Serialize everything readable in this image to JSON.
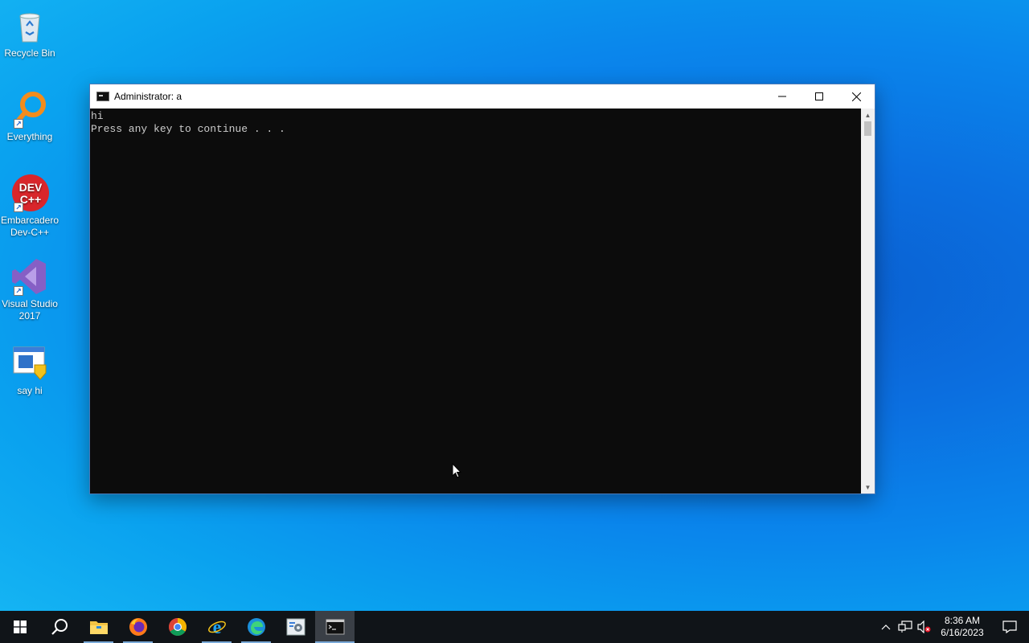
{
  "desktop": {
    "icons": [
      {
        "label": "Recycle Bin",
        "icon": "recycle-bin-icon"
      },
      {
        "label": "Everything",
        "icon": "everything-search-icon"
      },
      {
        "label": "Embarcadero Dev-C++",
        "icon": "devcpp-icon",
        "logo_text": "DEV C++"
      },
      {
        "label": "Visual Studio 2017",
        "icon": "visual-studio-icon"
      },
      {
        "label": "say hi",
        "icon": "shortcut-app-icon"
      }
    ]
  },
  "window": {
    "title": "Administrator:  a",
    "console_lines": [
      "hi",
      "Press any key to continue . . ."
    ],
    "controls": {
      "minimize": "minimize-icon",
      "maximize": "maximize-icon",
      "close": "close-icon"
    }
  },
  "taskbar": {
    "apps": [
      {
        "name": "start",
        "icon": "windows-start-icon"
      },
      {
        "name": "search",
        "icon": "search-icon"
      },
      {
        "name": "file-explorer",
        "icon": "folder-icon"
      },
      {
        "name": "firefox",
        "icon": "firefox-icon"
      },
      {
        "name": "chrome",
        "icon": "chrome-icon"
      },
      {
        "name": "internet-explorer",
        "icon": "ie-icon"
      },
      {
        "name": "edge",
        "icon": "edge-icon"
      },
      {
        "name": "control-panel",
        "icon": "settings-app-icon"
      },
      {
        "name": "command-prompt",
        "icon": "cmd-icon"
      }
    ],
    "clock": {
      "time": "8:36 AM",
      "date": "6/16/2023"
    }
  },
  "colors": {
    "console_bg": "#0c0c0c",
    "console_fg": "#cccccc",
    "taskbar_bg": "#101418"
  }
}
